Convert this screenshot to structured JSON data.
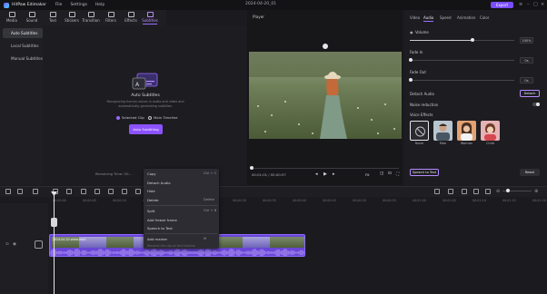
{
  "titlebar": {
    "app_name": "HitPaw Edimakor",
    "menus": [
      "File",
      "Settings",
      "Help"
    ],
    "project": "2024-04-20_01",
    "export_label": "Export"
  },
  "tabs": [
    {
      "label": "Media"
    },
    {
      "label": "Sound"
    },
    {
      "label": "Text"
    },
    {
      "label": "Stickers"
    },
    {
      "label": "Transition"
    },
    {
      "label": "Filters"
    },
    {
      "label": "Effects"
    },
    {
      "label": "Subtitles"
    }
  ],
  "leftnav": [
    {
      "label": "Auto Subtitles"
    },
    {
      "label": "Local Subtitles"
    },
    {
      "label": "Manual Subtitles"
    }
  ],
  "subtitles": {
    "title": "Auto Subtitles",
    "description": "Recognizing human voices in audio and video and automatically generating subtitles.",
    "option_selected": "Selected Clip",
    "option_main": "Main Timeline",
    "button": "Auto Subtitling",
    "remaining": "Remaining Time: 00:..."
  },
  "player": {
    "label": "Player",
    "timecode": "00:01:01 / 00:00:57",
    "zoom": "Fit"
  },
  "rightpanel": {
    "tabs": [
      "Video",
      "Audio",
      "Speed",
      "Animation",
      "Color"
    ],
    "volume_label": "Volume",
    "volume_value": "100%",
    "volume_level": 0.6,
    "fade_in_label": "Fade In",
    "fade_in_value": "0s",
    "fade_out_label": "Fade Out",
    "fade_out_value": "0s",
    "detach_label": "Detach Audio",
    "detach_button": "Detach",
    "noise_label": "Noise reduction",
    "voice_effects_label": "Voice Effects",
    "voices": [
      "None",
      "Man",
      "Woman",
      "Child"
    ],
    "speech_button": "Speech to Text",
    "reset_button": "Reset"
  },
  "timeline": {
    "ticks": [
      "00:00:00",
      "00:00:05",
      "00:00:10",
      "00:00:15",
      "00:00:20",
      "00:00:25",
      "00:00:30",
      "00:00:35",
      "00:00:40",
      "00:00:45",
      "00:00:50",
      "00:00:55",
      "00:01:00",
      "00:01:05",
      "00:01:10",
      "00:01:15",
      "00:01:20"
    ],
    "clip_label": "2024-04-20 video.mp4"
  },
  "context_menu": {
    "items": [
      {
        "label": "Copy",
        "key": "Ctrl + C"
      },
      {
        "label": "Detach Audio",
        "key": ""
      },
      {
        "label": "Hide",
        "key": ""
      },
      {
        "label": "Delete",
        "key": "Delete"
      },
      {
        "label": "Split",
        "key": "Ctrl + B"
      },
      {
        "label": "Add freeze frame",
        "key": ""
      },
      {
        "label": "Speech to Text",
        "key": ""
      },
      {
        "label": "Add marker",
        "key": "M"
      },
      {
        "label": "Rename the clip on the timeline",
        "key": ""
      }
    ]
  }
}
